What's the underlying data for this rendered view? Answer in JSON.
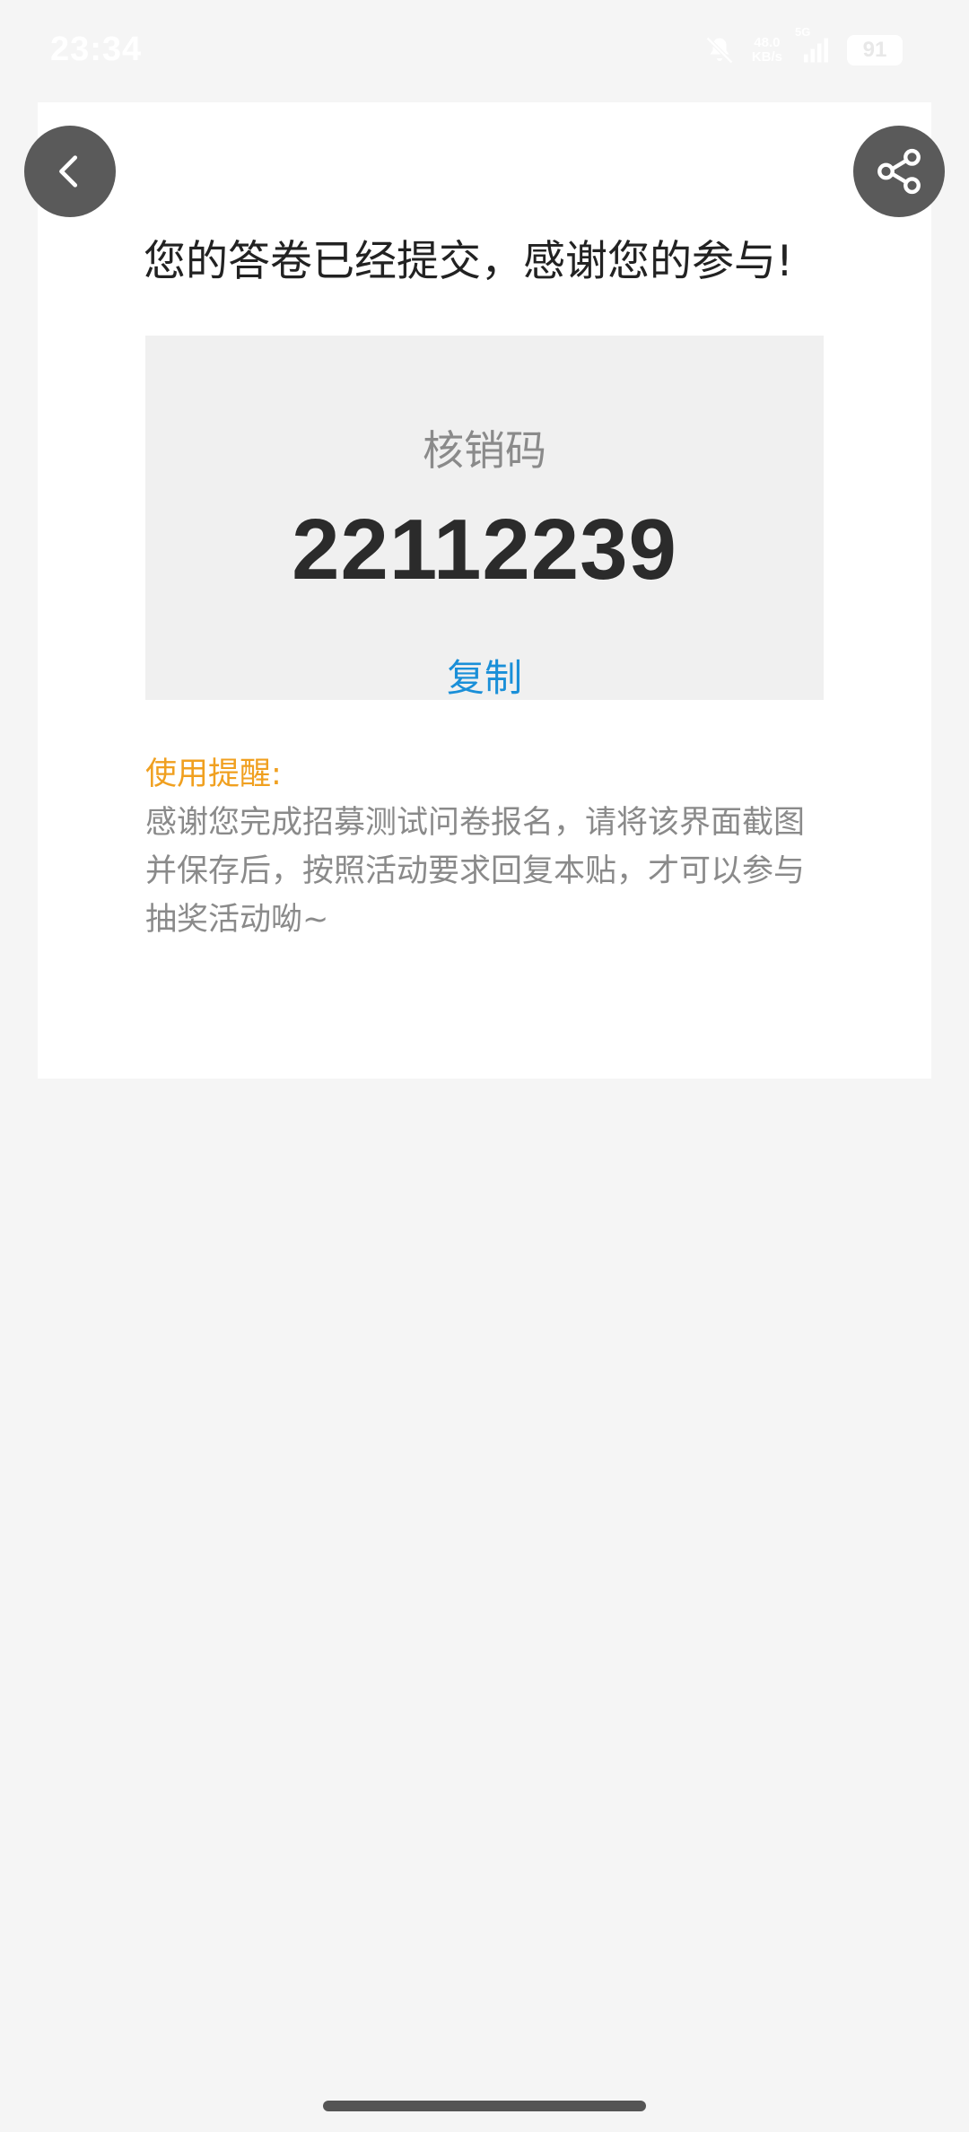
{
  "status_bar": {
    "time": "23:34",
    "net_speed_value": "48.0",
    "net_speed_unit": "KB/s",
    "signal_label": "5G",
    "battery": "91",
    "icons": [
      "mute-bell-icon",
      "signal-icon",
      "battery-icon"
    ]
  },
  "header": {
    "back_icon": "chevron-left-icon",
    "share_icon": "share-icon"
  },
  "main": {
    "title": "您的答卷已经提交，感谢您的参与!",
    "code_label": "核销码",
    "code_value": "22112239",
    "copy_label": "复制",
    "reminder_title": "使用提醒:",
    "reminder_body": "感谢您完成招募测试问卷报名，请将该界面截图并保存后，按照活动要求回复本贴，才可以参与抽奖活动呦~"
  },
  "colors": {
    "accent_blue": "#1a8fd8",
    "reminder_orange": "#f0a020",
    "button_gray": "#5a5a5a"
  }
}
